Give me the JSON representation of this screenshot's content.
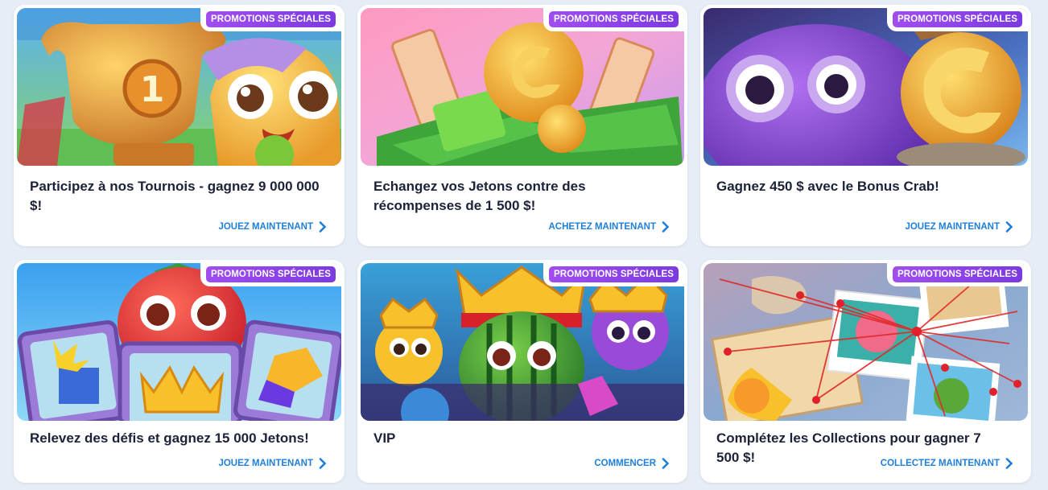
{
  "badge_label": "PROMOTIONS SPÉCIALES",
  "colors": {
    "badge": "#8b44e8",
    "cta": "#1f7fd8",
    "title": "#1c2238",
    "background": "#e6edf6"
  },
  "cards": [
    {
      "image": "trophy-mascot-illustration",
      "title": "Participez à nos Tournois - gagnez 9 000 000 $!",
      "cta": "JOUEZ MAINTENANT"
    },
    {
      "image": "free-bet-money-coins-illustration",
      "title": "Echangez vos Jetons contre des récompenses de 1 500 $!",
      "cta": "ACHETEZ MAINTENANT"
    },
    {
      "image": "crab-mascot-coin-illustration",
      "title": "Gagnez 450 $ avec le Bonus Crab!",
      "cta": "JOUEZ MAINTENANT"
    },
    {
      "image": "strawberry-challenges-illustration",
      "title": "Relevez des défis et gagnez 15 000 Jetons!",
      "cta": "JOUEZ MAINTENANT"
    },
    {
      "image": "vip-kings-illustration",
      "title": "VIP",
      "cta": "COMMENCER"
    },
    {
      "image": "collections-map-illustration",
      "title": "Complétez les Collections pour gagner 7 500 $!",
      "cta": "COLLECTEZ MAINTENANT"
    }
  ]
}
